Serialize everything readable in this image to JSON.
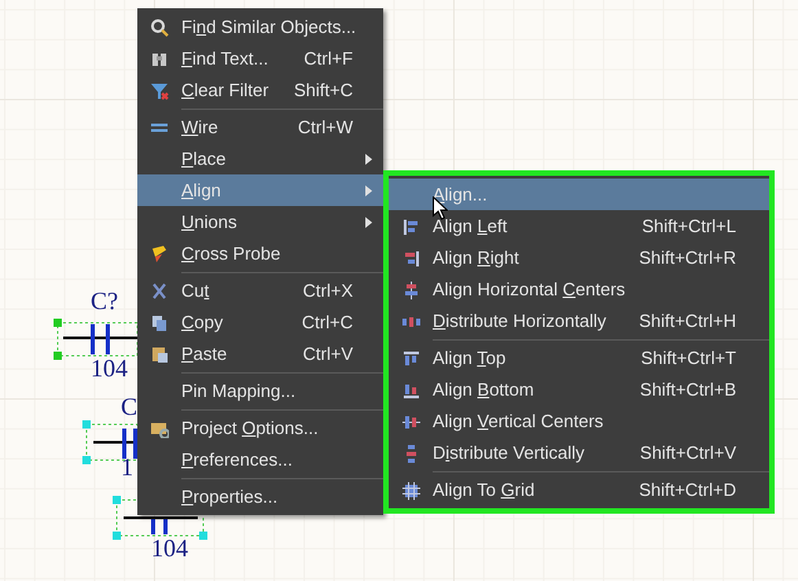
{
  "canvas": {
    "labels": [
      {
        "text": "C?"
      },
      {
        "text": "104"
      },
      {
        "text": "C"
      },
      {
        "text": "1"
      },
      {
        "text": "104"
      }
    ]
  },
  "menu": {
    "items": [
      {
        "kind": "item",
        "label": {
          "pre": "Fi",
          "key": "n",
          "post": "d Similar Objects..."
        },
        "selected": false
      },
      {
        "kind": "item",
        "label": {
          "key": "F",
          "post": "ind Text..."
        },
        "shortcut": "Ctrl+F",
        "selected": false
      },
      {
        "kind": "item",
        "label": {
          "key": "C",
          "post": "lear Filter"
        },
        "shortcut": "Shift+C",
        "selected": false
      },
      {
        "kind": "separator"
      },
      {
        "kind": "item",
        "label": {
          "key": "W",
          "post": "ire"
        },
        "shortcut": "Ctrl+W",
        "selected": false
      },
      {
        "kind": "item",
        "label": {
          "key": "P",
          "post": "lace"
        },
        "submenu": true,
        "selected": false
      },
      {
        "kind": "item",
        "label": {
          "key": "A",
          "post": "lign"
        },
        "submenu": true,
        "selected": true
      },
      {
        "kind": "item",
        "label": {
          "key": "U",
          "post": "nions"
        },
        "submenu": true,
        "selected": false
      },
      {
        "kind": "item",
        "label": {
          "key": "C",
          "post": "ross Probe"
        },
        "selected": false
      },
      {
        "kind": "separator"
      },
      {
        "kind": "item",
        "label": {
          "pre": "Cu",
          "key": "t"
        },
        "shortcut": "Ctrl+X",
        "selected": false
      },
      {
        "kind": "item",
        "label": {
          "key": "C",
          "post": "opy"
        },
        "shortcut": "Ctrl+C",
        "selected": false
      },
      {
        "kind": "item",
        "label": {
          "key": "P",
          "post": "aste"
        },
        "shortcut": "Ctrl+V",
        "selected": false
      },
      {
        "kind": "separator"
      },
      {
        "kind": "item",
        "label": {
          "pre": "Pin Mapping..."
        },
        "selected": false
      },
      {
        "kind": "separator"
      },
      {
        "kind": "item",
        "label": {
          "pre": "Project ",
          "key": "O",
          "post": "ptions..."
        },
        "selected": false
      },
      {
        "kind": "item",
        "label": {
          "key": "P",
          "post": "references..."
        },
        "selected": false
      },
      {
        "kind": "separator"
      },
      {
        "kind": "item",
        "label": {
          "key": "P",
          "post": "roperties..."
        },
        "selected": false
      }
    ]
  },
  "submenu": {
    "items": [
      {
        "kind": "item",
        "label": {
          "key": "A",
          "post": "lign..."
        },
        "selected": true
      },
      {
        "kind": "item",
        "label": {
          "pre": "Align ",
          "key": "L",
          "post": "eft"
        },
        "shortcut": "Shift+Ctrl+L",
        "selected": false
      },
      {
        "kind": "item",
        "label": {
          "pre": "Align ",
          "key": "R",
          "post": "ight"
        },
        "shortcut": "Shift+Ctrl+R",
        "selected": false
      },
      {
        "kind": "item",
        "label": {
          "pre": "Align Horizontal ",
          "key": "C",
          "post": "enters"
        },
        "selected": false
      },
      {
        "kind": "item",
        "label": {
          "key": "D",
          "post": "istribute Horizontally"
        },
        "shortcut": "Shift+Ctrl+H",
        "selected": false
      },
      {
        "kind": "separator"
      },
      {
        "kind": "item",
        "label": {
          "pre": "Align ",
          "key": "T",
          "post": "op"
        },
        "shortcut": "Shift+Ctrl+T",
        "selected": false
      },
      {
        "kind": "item",
        "label": {
          "pre": "Align ",
          "key": "B",
          "post": "ottom"
        },
        "shortcut": "Shift+Ctrl+B",
        "selected": false
      },
      {
        "kind": "item",
        "label": {
          "pre": "Align ",
          "key": "V",
          "post": "ertical Centers"
        },
        "selected": false
      },
      {
        "kind": "item",
        "label": {
          "pre": "D",
          "key": "i",
          "post": "stribute Vertically"
        },
        "shortcut": "Shift+Ctrl+V",
        "selected": false
      },
      {
        "kind": "separator"
      },
      {
        "kind": "item",
        "label": {
          "pre": "Align To ",
          "key": "G",
          "post": "rid"
        },
        "shortcut": "Shift+Ctrl+D",
        "selected": false
      }
    ]
  }
}
